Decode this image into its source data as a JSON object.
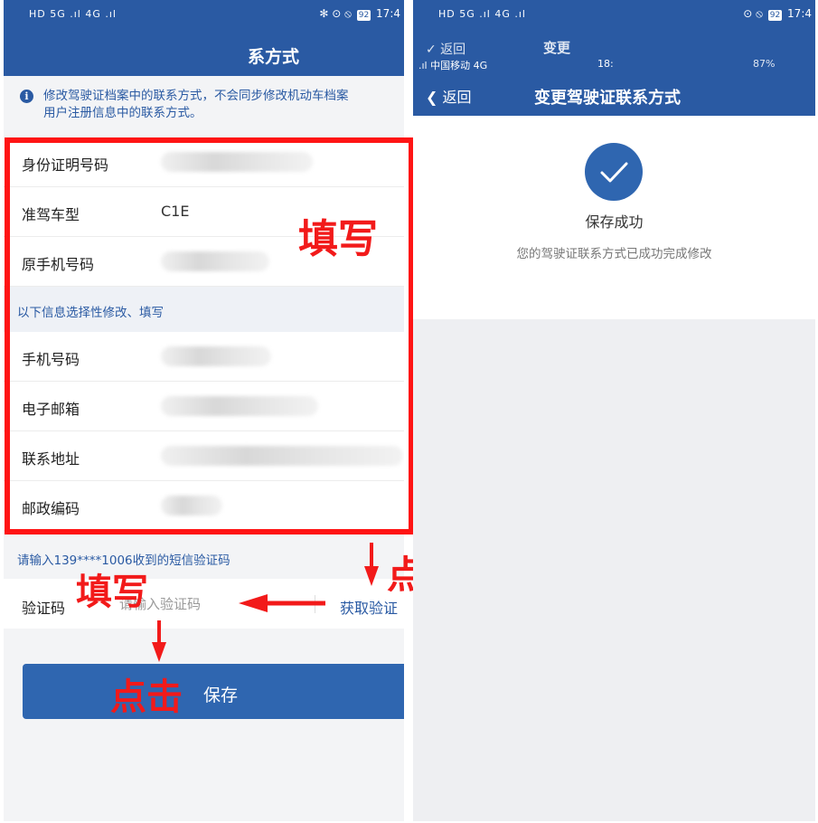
{
  "left_screen": {
    "status": {
      "signal": "HD 5G .ıl 4G .ıl",
      "icons": "✻ ⊙ ⦸",
      "battery": "92",
      "time": "17:4"
    },
    "title": "系方式",
    "notice": {
      "icon": "info-icon",
      "line1": "修改驾驶证档案中的联系方式，不会同步修改机动车档案",
      "line2": "用户注册信息中的联系方式。"
    },
    "fields": {
      "id_number": {
        "label": "身份证明号码"
      },
      "vehicle_class": {
        "label": "准驾车型",
        "value": "C1E"
      },
      "old_phone": {
        "label": "原手机号码"
      },
      "section_title": "以下信息选择性修改、填写",
      "phone": {
        "label": "手机号码"
      },
      "email": {
        "label": "电子邮箱"
      },
      "address": {
        "label": "联系地址"
      },
      "postcode": {
        "label": "邮政编码"
      }
    },
    "sms_hint": "请输入139****1006收到的短信验证码",
    "code": {
      "label": "验证码",
      "placeholder": "请输入验证码",
      "get_code": "获取验证"
    },
    "save_label": "保存"
  },
  "annotations": {
    "fill_1": "填写",
    "click_1": "点击",
    "fill_2": "填写",
    "click_2": "点击",
    "colors": {
      "frame": "#ff1414",
      "text": "#f21a1a"
    }
  },
  "right_screen": {
    "status": {
      "signal": "HD 5G .ıl 4G .ıl",
      "icons": "⊙ ⦸",
      "battery": "92",
      "time": "17:4"
    },
    "ghost": {
      "back": "✓ 返回",
      "title": "变更",
      "carrier": ".ıl 中国移动 4G",
      "time": "18:",
      "battery": "87%"
    },
    "back_label": "返回",
    "title": "变更驾驶证联系方式",
    "success_title": "保存成功",
    "success_desc": "您的驾驶证联系方式已成功完成修改"
  },
  "colors": {
    "primary": "#2a5aa3",
    "button": "#2f66b0",
    "background": "#f3f4f6"
  }
}
